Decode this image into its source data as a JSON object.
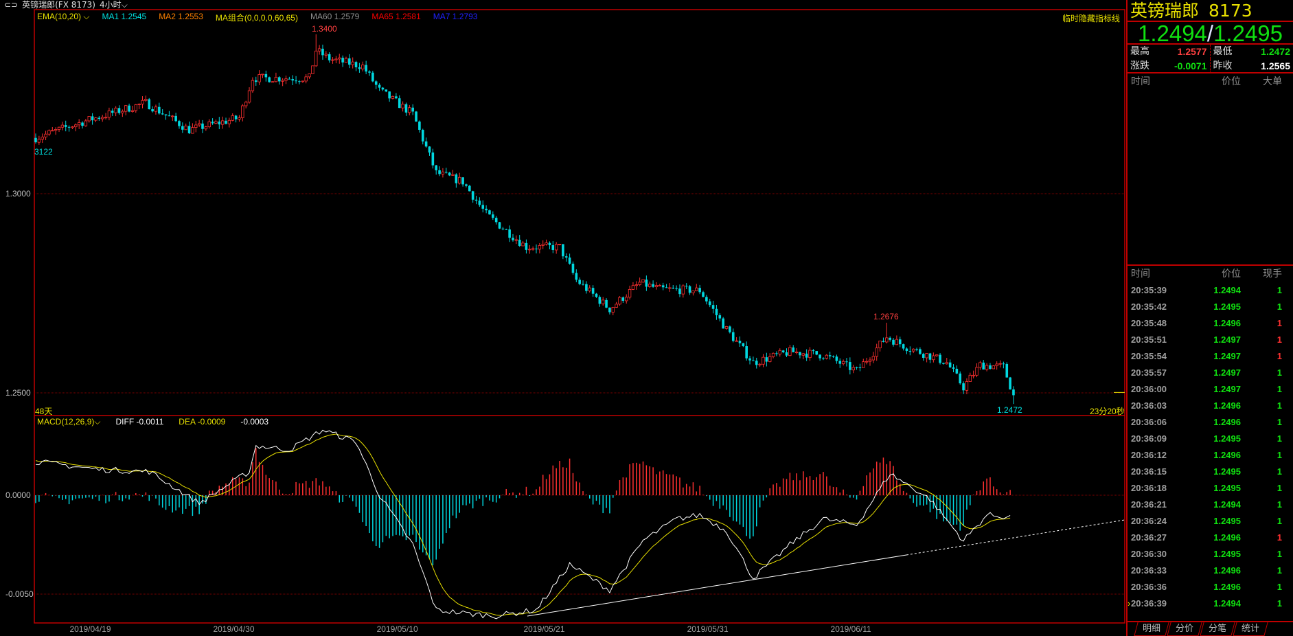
{
  "window": {
    "title": "英镑瑞郎(FX 8173)",
    "period": "4小时"
  },
  "legend": [
    {
      "text": "EMA(10,20)",
      "color": "#e8e000"
    },
    {
      "text": "MA1 1.2545",
      "color": "#00e0e0"
    },
    {
      "text": "MA2 1.2553",
      "color": "#ff8000"
    },
    {
      "text": "MA组合(0,0,0,0,60,65)",
      "color": "#e8e000"
    },
    {
      "text": "MA60 1.2579",
      "color": "#909090"
    },
    {
      "text": "MA65 1.2581",
      "color": "#ff0000"
    },
    {
      "text": "MA7 1.2793",
      "color": "#2020ff"
    }
  ],
  "hide_lines_label": "临时隐藏指标线",
  "macd_legend": {
    "name": "MACD(12,26,9)",
    "diff": "DIFF -0.0011",
    "dea": "DEA -0.0009",
    "macd": "-0.0003"
  },
  "labels": {
    "high": "1.3400",
    "peak2": "1.2676",
    "low": "1.2472",
    "start": "3122",
    "days": "48天",
    "countdown": "23分20秒"
  },
  "chart_data": {
    "type": "candlestick",
    "price_axis": {
      "ticks": [
        "1.3000",
        "1.2500"
      ],
      "values": [
        1.3,
        1.25
      ],
      "range": [
        1.2443,
        1.3462
      ]
    },
    "macd_axis": {
      "ticks": [
        "0.0000",
        "-0.0050"
      ],
      "values": [
        0,
        -0.005
      ],
      "range": [
        -0.00646,
        0.00403
      ]
    },
    "x_ticks": [
      {
        "label": "2019/04/19",
        "index": 18
      },
      {
        "label": "2019/04/30",
        "index": 61
      },
      {
        "label": "2019/05/10",
        "index": 110
      },
      {
        "label": "2019/05/21",
        "index": 154
      },
      {
        "label": "2019/05/31",
        "index": 203
      },
      {
        "label": "2019/06/11",
        "index": 246
      }
    ],
    "candle_count": 294,
    "close_path": [
      [
        0,
        1.314
      ],
      [
        14,
        1.318
      ],
      [
        33,
        1.3228
      ],
      [
        46,
        1.316
      ],
      [
        61,
        1.319
      ],
      [
        65,
        1.329
      ],
      [
        82,
        1.329
      ],
      [
        84,
        1.336
      ],
      [
        88,
        1.3338
      ],
      [
        98,
        1.332
      ],
      [
        103,
        1.3259
      ],
      [
        113,
        1.32
      ],
      [
        120,
        1.3052
      ],
      [
        128,
        1.303
      ],
      [
        135,
        1.2948
      ],
      [
        147,
        1.2866
      ],
      [
        157,
        1.2866
      ],
      [
        162,
        1.2783
      ],
      [
        172,
        1.271
      ],
      [
        181,
        1.2776
      ],
      [
        187,
        1.276
      ],
      [
        199,
        1.2757
      ],
      [
        207,
        1.2659
      ],
      [
        215,
        1.2576
      ],
      [
        226,
        1.2603
      ],
      [
        236,
        1.2595
      ],
      [
        246,
        1.2555
      ],
      [
        255,
        1.264
      ],
      [
        261,
        1.2615
      ],
      [
        273,
        1.2576
      ],
      [
        278,
        1.2514
      ],
      [
        283,
        1.257
      ],
      [
        290,
        1.2565
      ],
      [
        293,
        1.2494
      ]
    ],
    "marked_extremes": [
      {
        "index": 84,
        "high": 1.34
      },
      {
        "index": 255,
        "high": 1.2676
      },
      {
        "index": 293,
        "low": 1.2472
      }
    ],
    "diff_path": [
      [
        0,
        0.0017
      ],
      [
        19,
        0.0013
      ],
      [
        34,
        0.0012
      ],
      [
        49,
        -0.0004
      ],
      [
        64,
        0.0012
      ],
      [
        66,
        0.0025
      ],
      [
        76,
        0.0023
      ],
      [
        86,
        0.0033
      ],
      [
        96,
        0.0027
      ],
      [
        103,
        0.0
      ],
      [
        113,
        -0.0025
      ],
      [
        120,
        -0.0058
      ],
      [
        130,
        -0.006
      ],
      [
        138,
        -0.0061
      ],
      [
        150,
        -0.0058
      ],
      [
        160,
        -0.0035
      ],
      [
        172,
        -0.0048
      ],
      [
        182,
        -0.0023
      ],
      [
        192,
        -0.0012
      ],
      [
        199,
        -0.001
      ],
      [
        207,
        -0.0018
      ],
      [
        215,
        -0.0042
      ],
      [
        226,
        -0.0025
      ],
      [
        236,
        -0.0012
      ],
      [
        246,
        -0.0015
      ],
      [
        256,
        0.0011
      ],
      [
        268,
        -0.0002
      ],
      [
        278,
        -0.0023
      ],
      [
        285,
        -0.001
      ],
      [
        292,
        -0.0011
      ]
    ],
    "colors": {
      "up": "#ff3030",
      "down": "#00d8e0",
      "diff": "#ffffff",
      "dea": "#e8e000"
    }
  },
  "panel": {
    "name": "英镑瑞郎",
    "code": "8173",
    "bid": "1.2494",
    "ask": "1.2495",
    "stats": [
      {
        "k": "最高",
        "v": "1.2577",
        "c": "#ff4040"
      },
      {
        "k": "最低",
        "v": "1.2472",
        "c": "#10e010"
      },
      {
        "k": "涨跌",
        "v": "-0.0071",
        "c": "#10e010"
      },
      {
        "k": "昨收",
        "v": "1.2565",
        "c": "#ffffff"
      }
    ],
    "big_header": [
      "时间",
      "价位",
      "大单"
    ],
    "tick_header": [
      "时间",
      "价位",
      "现手"
    ],
    "ticks": [
      {
        "t": "20:35:39",
        "p": "1.2494",
        "q": "1",
        "c": "#10e010"
      },
      {
        "t": "20:35:42",
        "p": "1.2495",
        "q": "1",
        "c": "#10e010"
      },
      {
        "t": "20:35:48",
        "p": "1.2496",
        "q": "1",
        "c": "#ff3030"
      },
      {
        "t": "20:35:51",
        "p": "1.2497",
        "q": "1",
        "c": "#ff3030"
      },
      {
        "t": "20:35:54",
        "p": "1.2497",
        "q": "1",
        "c": "#ff3030"
      },
      {
        "t": "20:35:57",
        "p": "1.2497",
        "q": "1",
        "c": "#10e010"
      },
      {
        "t": "20:36:00",
        "p": "1.2497",
        "q": "1",
        "c": "#10e010"
      },
      {
        "t": "20:36:03",
        "p": "1.2496",
        "q": "1",
        "c": "#10e010"
      },
      {
        "t": "20:36:06",
        "p": "1.2496",
        "q": "1",
        "c": "#10e010"
      },
      {
        "t": "20:36:09",
        "p": "1.2495",
        "q": "1",
        "c": "#10e010"
      },
      {
        "t": "20:36:12",
        "p": "1.2496",
        "q": "1",
        "c": "#10e010"
      },
      {
        "t": "20:36:15",
        "p": "1.2495",
        "q": "1",
        "c": "#10e010"
      },
      {
        "t": "20:36:18",
        "p": "1.2495",
        "q": "1",
        "c": "#10e010"
      },
      {
        "t": "20:36:21",
        "p": "1.2494",
        "q": "1",
        "c": "#10e010"
      },
      {
        "t": "20:36:24",
        "p": "1.2495",
        "q": "1",
        "c": "#10e010"
      },
      {
        "t": "20:36:27",
        "p": "1.2496",
        "q": "1",
        "c": "#ff3030"
      },
      {
        "t": "20:36:30",
        "p": "1.2495",
        "q": "1",
        "c": "#10e010"
      },
      {
        "t": "20:36:33",
        "p": "1.2496",
        "q": "1",
        "c": "#10e010"
      },
      {
        "t": "20:36:36",
        "p": "1.2496",
        "q": "1",
        "c": "#10e010"
      },
      {
        "t": "20:36:39",
        "p": "1.2494",
        "q": "1",
        "c": "#10e010"
      }
    ],
    "tabs": [
      "明细",
      "分价",
      "分笔",
      "统计"
    ]
  }
}
